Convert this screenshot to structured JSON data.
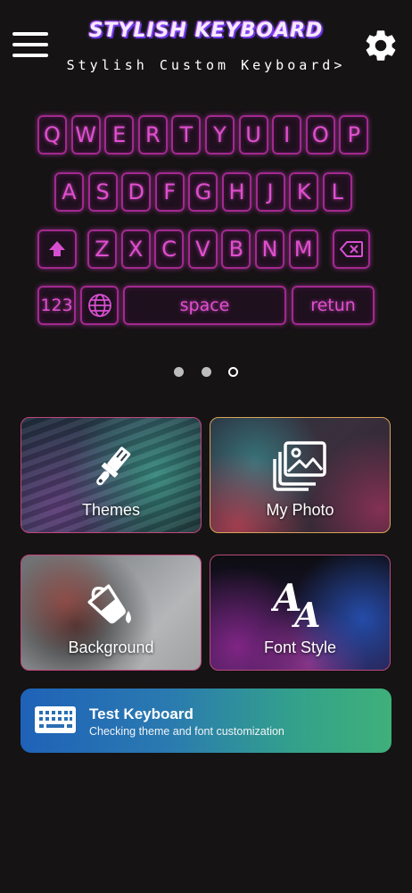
{
  "header": {
    "title": "STYLISH KEYBOARD",
    "subtitle": "Stylish Custom Keyboard>",
    "menu_icon": "hamburger-menu-icon",
    "settings_icon": "gear-icon"
  },
  "keyboard_preview": {
    "row1": [
      "Q",
      "W",
      "E",
      "R",
      "T",
      "Y",
      "U",
      "I",
      "O",
      "P"
    ],
    "row2": [
      "A",
      "S",
      "D",
      "F",
      "G",
      "H",
      "J",
      "K",
      "L"
    ],
    "row3": [
      "Z",
      "X",
      "C",
      "V",
      "B",
      "N",
      "M"
    ],
    "shift_icon": "shift-arrow-icon",
    "backspace_icon": "backspace-icon",
    "numbers_label": "123",
    "globe_icon": "globe-icon",
    "space_label": "space",
    "return_label": "retun",
    "key_color": "#e04fcf"
  },
  "pager": {
    "count": 3,
    "active_index": 2
  },
  "cards": {
    "themes": {
      "label": "Themes",
      "icon": "paintbrush-icon"
    },
    "my_photo": {
      "label": "My Photo",
      "icon": "photo-gallery-icon"
    },
    "background": {
      "label": "Background",
      "icon": "paint-bucket-icon"
    },
    "font_style": {
      "label": "Font Style",
      "icon": "font-aa-icon"
    }
  },
  "test_keyboard": {
    "title": "Test Keyboard",
    "subtitle": "Checking theme and font customization",
    "icon": "keyboard-icon"
  },
  "colors": {
    "background": "#151314",
    "neon_pink": "#e04fcf",
    "banner_start": "#1f62b8",
    "banner_end": "#3fb07a"
  }
}
